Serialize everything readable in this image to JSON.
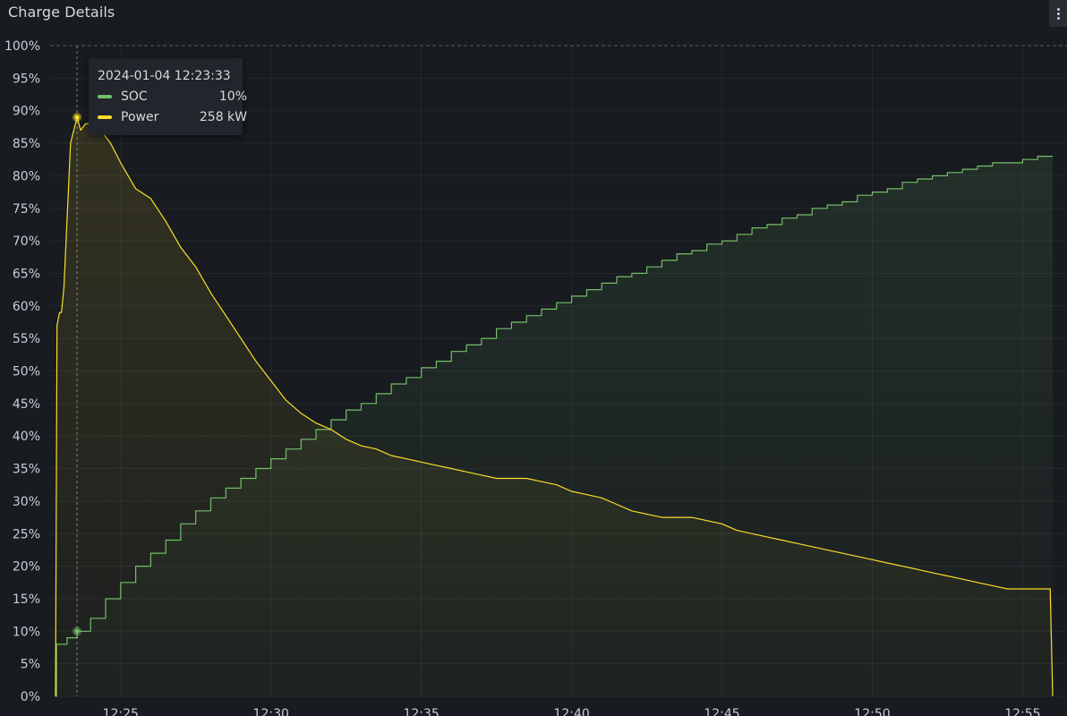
{
  "panel": {
    "title": "Charge Details",
    "menu_icon": "kebab-menu-icon"
  },
  "tooltip": {
    "time": "2024-01-04 12:23:33",
    "rows": [
      {
        "name": "SOC",
        "value": "10%",
        "color": "#73bf69"
      },
      {
        "name": "Power",
        "value": "258 kW",
        "color": "#fade2a"
      }
    ]
  },
  "chart_data": {
    "type": "area",
    "y_axis": {
      "min": 0,
      "max": 100,
      "unit": "%",
      "ticks": [
        "0%",
        "5%",
        "10%",
        "15%",
        "20%",
        "25%",
        "30%",
        "35%",
        "40%",
        "45%",
        "50%",
        "55%",
        "60%",
        "65%",
        "70%",
        "75%",
        "80%",
        "85%",
        "90%",
        "95%",
        "100%"
      ]
    },
    "x_axis": {
      "range": [
        "12:22:50",
        "12:56:00"
      ],
      "ticks": [
        {
          "label": "12:25",
          "t": "12:25:00"
        },
        {
          "label": "12:30",
          "t": "12:30:00"
        },
        {
          "label": "12:35",
          "t": "12:35:00"
        },
        {
          "label": "12:40",
          "t": "12:40:00"
        },
        {
          "label": "12:45",
          "t": "12:45:00"
        },
        {
          "label": "12:50",
          "t": "12:50:00"
        },
        {
          "label": "12:55",
          "t": "12:55:00"
        }
      ]
    },
    "grid": true,
    "cursor_time": "12:23:33",
    "series": [
      {
        "name": "SOC",
        "color": "#73bf69",
        "step": true,
        "points": [
          [
            "12:22:50",
            0
          ],
          [
            "12:22:52",
            8
          ],
          [
            "12:23:10",
            8
          ],
          [
            "12:23:13",
            9
          ],
          [
            "12:23:27",
            9
          ],
          [
            "12:23:33",
            10
          ],
          [
            "12:23:50",
            10
          ],
          [
            "12:24:00",
            12
          ],
          [
            "12:24:30",
            15
          ],
          [
            "12:25:00",
            17.5
          ],
          [
            "12:25:30",
            20
          ],
          [
            "12:26:00",
            22
          ],
          [
            "12:26:30",
            24
          ],
          [
            "12:27:00",
            26.5
          ],
          [
            "12:27:30",
            28.5
          ],
          [
            "12:28:00",
            30.5
          ],
          [
            "12:28:30",
            32
          ],
          [
            "12:29:00",
            33.5
          ],
          [
            "12:29:30",
            35
          ],
          [
            "12:30:00",
            36.5
          ],
          [
            "12:30:30",
            38
          ],
          [
            "12:31:00",
            39.5
          ],
          [
            "12:31:30",
            41
          ],
          [
            "12:32:00",
            42.5
          ],
          [
            "12:32:30",
            44
          ],
          [
            "12:33:00",
            45
          ],
          [
            "12:33:30",
            46.5
          ],
          [
            "12:34:00",
            48
          ],
          [
            "12:34:30",
            49
          ],
          [
            "12:35:00",
            50.5
          ],
          [
            "12:35:30",
            51.5
          ],
          [
            "12:36:00",
            53
          ],
          [
            "12:36:30",
            54
          ],
          [
            "12:37:00",
            55
          ],
          [
            "12:37:30",
            56.5
          ],
          [
            "12:38:00",
            57.5
          ],
          [
            "12:38:30",
            58.5
          ],
          [
            "12:39:00",
            59.5
          ],
          [
            "12:39:30",
            60.5
          ],
          [
            "12:40:00",
            61.5
          ],
          [
            "12:40:30",
            62.5
          ],
          [
            "12:41:00",
            63.5
          ],
          [
            "12:41:30",
            64.5
          ],
          [
            "12:42:00",
            65
          ],
          [
            "12:42:30",
            66
          ],
          [
            "12:43:00",
            67
          ],
          [
            "12:43:30",
            68
          ],
          [
            "12:44:00",
            68.5
          ],
          [
            "12:44:30",
            69.5
          ],
          [
            "12:45:00",
            70
          ],
          [
            "12:45:30",
            71
          ],
          [
            "12:46:00",
            72
          ],
          [
            "12:46:30",
            72.5
          ],
          [
            "12:47:00",
            73.5
          ],
          [
            "12:47:30",
            74
          ],
          [
            "12:48:00",
            75
          ],
          [
            "12:48:30",
            75.5
          ],
          [
            "12:49:00",
            76
          ],
          [
            "12:49:30",
            77
          ],
          [
            "12:50:00",
            77.5
          ],
          [
            "12:50:30",
            78
          ],
          [
            "12:51:00",
            79
          ],
          [
            "12:51:30",
            79.5
          ],
          [
            "12:52:00",
            80
          ],
          [
            "12:52:30",
            80.5
          ],
          [
            "12:53:00",
            81
          ],
          [
            "12:53:30",
            81.5
          ],
          [
            "12:54:00",
            82
          ],
          [
            "12:55:00",
            82.5
          ],
          [
            "12:55:30",
            83
          ],
          [
            "12:56:00",
            83
          ]
        ]
      },
      {
        "name": "Power",
        "color": "#fade2a",
        "step": false,
        "points": [
          [
            "12:22:50",
            0
          ],
          [
            "12:22:53",
            57
          ],
          [
            "12:22:58",
            59
          ],
          [
            "12:23:02",
            59
          ],
          [
            "12:23:07",
            63
          ],
          [
            "12:23:20",
            85
          ],
          [
            "12:23:33",
            89
          ],
          [
            "12:23:40",
            87
          ],
          [
            "12:23:50",
            88
          ],
          [
            "12:24:00",
            88
          ],
          [
            "12:24:10",
            89
          ],
          [
            "12:24:20",
            87
          ],
          [
            "12:24:40",
            85
          ],
          [
            "12:25:00",
            82
          ],
          [
            "12:25:30",
            78
          ],
          [
            "12:26:00",
            76.5
          ],
          [
            "12:26:30",
            73
          ],
          [
            "12:27:00",
            69
          ],
          [
            "12:27:30",
            66
          ],
          [
            "12:28:00",
            62
          ],
          [
            "12:28:30",
            58.5
          ],
          [
            "12:29:00",
            55
          ],
          [
            "12:29:30",
            51.5
          ],
          [
            "12:30:00",
            48.5
          ],
          [
            "12:30:30",
            45.5
          ],
          [
            "12:31:00",
            43.5
          ],
          [
            "12:31:30",
            42
          ],
          [
            "12:32:00",
            41
          ],
          [
            "12:32:30",
            39.5
          ],
          [
            "12:33:00",
            38.5
          ],
          [
            "12:33:30",
            38
          ],
          [
            "12:34:00",
            37
          ],
          [
            "12:34:30",
            36.5
          ],
          [
            "12:35:00",
            36
          ],
          [
            "12:35:30",
            35.5
          ],
          [
            "12:36:00",
            35
          ],
          [
            "12:36:30",
            34.5
          ],
          [
            "12:37:00",
            34
          ],
          [
            "12:37:30",
            33.5
          ],
          [
            "12:38:00",
            33.5
          ],
          [
            "12:38:30",
            33.5
          ],
          [
            "12:39:00",
            33
          ],
          [
            "12:39:30",
            32.5
          ],
          [
            "12:40:00",
            31.5
          ],
          [
            "12:40:30",
            31
          ],
          [
            "12:41:00",
            30.5
          ],
          [
            "12:41:30",
            29.5
          ],
          [
            "12:42:00",
            28.5
          ],
          [
            "12:42:30",
            28
          ],
          [
            "12:43:00",
            27.5
          ],
          [
            "12:43:30",
            27.5
          ],
          [
            "12:44:00",
            27.5
          ],
          [
            "12:44:30",
            27
          ],
          [
            "12:45:00",
            26.5
          ],
          [
            "12:45:30",
            25.5
          ],
          [
            "12:46:00",
            25
          ],
          [
            "12:46:30",
            24.5
          ],
          [
            "12:47:00",
            24
          ],
          [
            "12:47:30",
            23.5
          ],
          [
            "12:48:00",
            23
          ],
          [
            "12:48:30",
            22.5
          ],
          [
            "12:49:00",
            22
          ],
          [
            "12:49:30",
            21.5
          ],
          [
            "12:50:00",
            21
          ],
          [
            "12:50:30",
            20.5
          ],
          [
            "12:51:00",
            20
          ],
          [
            "12:51:30",
            19.5
          ],
          [
            "12:52:00",
            19
          ],
          [
            "12:52:30",
            18.5
          ],
          [
            "12:53:00",
            18
          ],
          [
            "12:53:30",
            17.5
          ],
          [
            "12:54:00",
            17
          ],
          [
            "12:54:30",
            16.5
          ],
          [
            "12:55:00",
            16.5
          ],
          [
            "12:55:30",
            16.5
          ],
          [
            "12:55:55",
            16.5
          ],
          [
            "12:56:00",
            0
          ]
        ]
      }
    ]
  }
}
